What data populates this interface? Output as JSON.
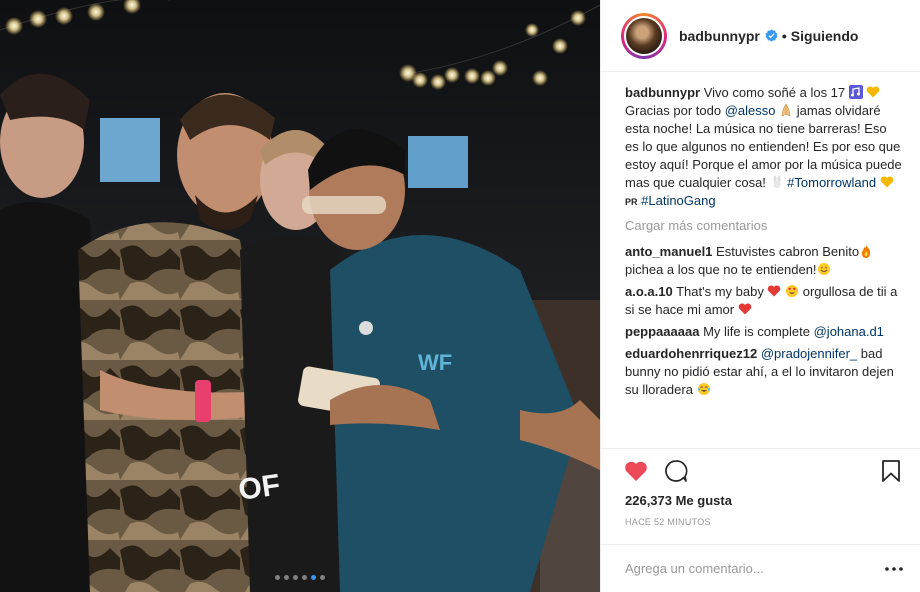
{
  "header": {
    "username": "badbunnypr",
    "separator": "•",
    "follow_status": "Siguiendo"
  },
  "caption": {
    "user": "badbunnypr",
    "text_1": "Vivo como soñé a los 17",
    "text_2": "Gracias por todo",
    "mention": "@alesso",
    "text_3": "jamas olvidaré esta noche! La música no tiene barreras! Eso es lo que algunos no entienden! Es por eso que estoy aquí! Porque el amor por la música puede mas que cualquier cosa!",
    "hashtag_1": "#Tomorrowland",
    "pr": "PR",
    "hashtag_2": "#LatinoGang"
  },
  "load_more": "Cargar más comentarios",
  "comments": [
    {
      "user": "anto_manuel1",
      "text_a": "Estuvistes cabron Benito",
      "text_b": "pichea a los que no te entienden!"
    },
    {
      "user": "a.o.a.10",
      "text_a": "That's my baby",
      "text_b": "orgullosa de tii a si se hace mi amor"
    },
    {
      "user": "peppaaaaaa",
      "text_a": "My life is complete",
      "mention": "@johana.d1"
    },
    {
      "user": "eduardohenrriquez12",
      "mention": "@pradojennifer_",
      "text_a": "bad bunny no pidió estar ahí, a el lo invitaron dejen su lloradera"
    }
  ],
  "likes": "226,373 Me gusta",
  "time": "HACE 52 MINUTOS",
  "add_comment": {
    "placeholder": "Agrega un comentario..."
  },
  "more": "•••",
  "carousel": {
    "count": 6,
    "active_index": 4
  },
  "colors": {
    "link": "#003569",
    "heart": "#ed4956",
    "accent": "#3897f0",
    "muted": "#999999"
  },
  "icons": [
    "heart-icon",
    "comment-icon",
    "bookmark-icon",
    "verified-icon",
    "more-icon"
  ]
}
